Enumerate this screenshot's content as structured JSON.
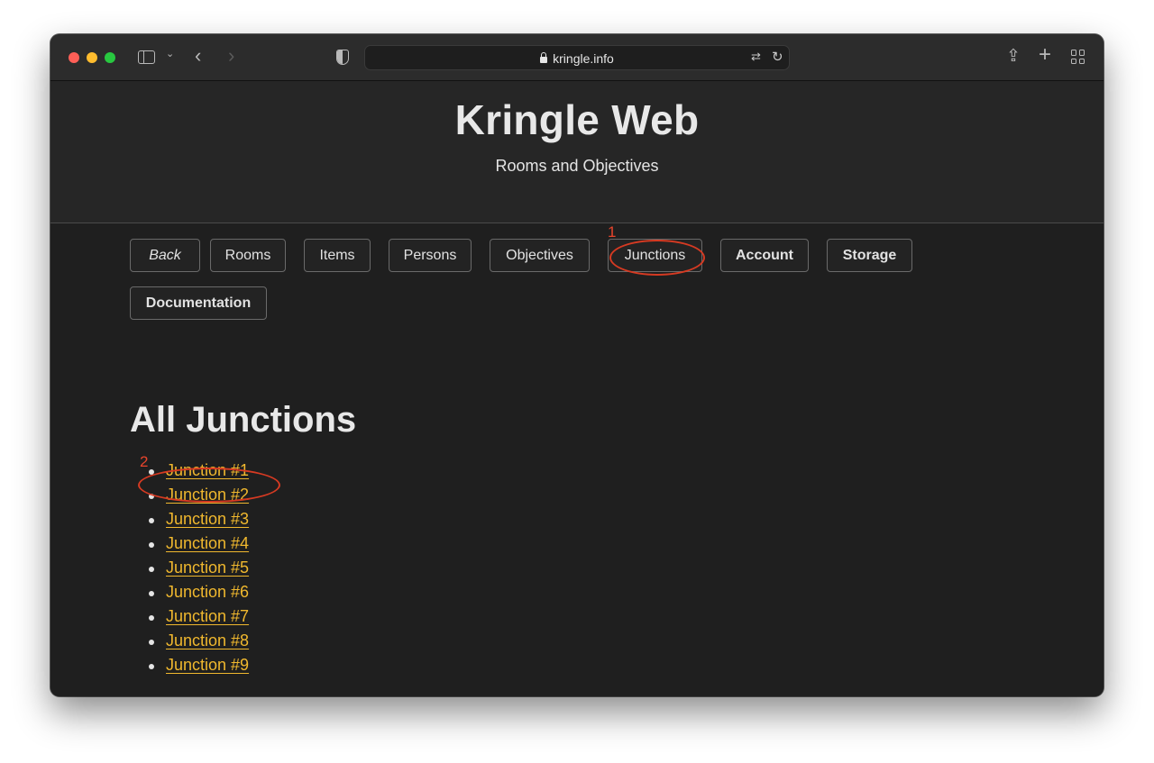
{
  "browser": {
    "url": "kringle.info"
  },
  "header": {
    "title": "Kringle Web",
    "subtitle": "Rooms and Objectives"
  },
  "nav": {
    "items": [
      {
        "label": "Back",
        "style": "italic"
      },
      {
        "label": "Rooms",
        "style": "normal"
      },
      {
        "label": "Items",
        "style": "normal"
      },
      {
        "label": "Persons",
        "style": "normal"
      },
      {
        "label": "Objectives",
        "style": "normal"
      },
      {
        "label": "Junctions",
        "style": "normal"
      },
      {
        "label": "Account",
        "style": "bold"
      },
      {
        "label": "Storage",
        "style": "bold"
      },
      {
        "label": "Documentation",
        "style": "bold"
      }
    ]
  },
  "main": {
    "heading": "All Junctions",
    "junctions": [
      {
        "label": "Junction #1",
        "underlined": true
      },
      {
        "label": "Junction #2",
        "underlined": true
      },
      {
        "label": "Junction #3",
        "underlined": true
      },
      {
        "label": "Junction #4",
        "underlined": true
      },
      {
        "label": "Junction #5",
        "underlined": true
      },
      {
        "label": "Junction #6",
        "underlined": false
      },
      {
        "label": "Junction #7",
        "underlined": true
      },
      {
        "label": "Junction #8",
        "underlined": true
      },
      {
        "label": "Junction #9",
        "underlined": true
      }
    ]
  },
  "annotations": [
    {
      "number": "1",
      "target": "Junctions"
    },
    {
      "number": "2",
      "target": "Junction #1"
    }
  ],
  "colors": {
    "link": "#f0b82e",
    "annotation": "#e8452c",
    "background": "#1f1f1f"
  }
}
